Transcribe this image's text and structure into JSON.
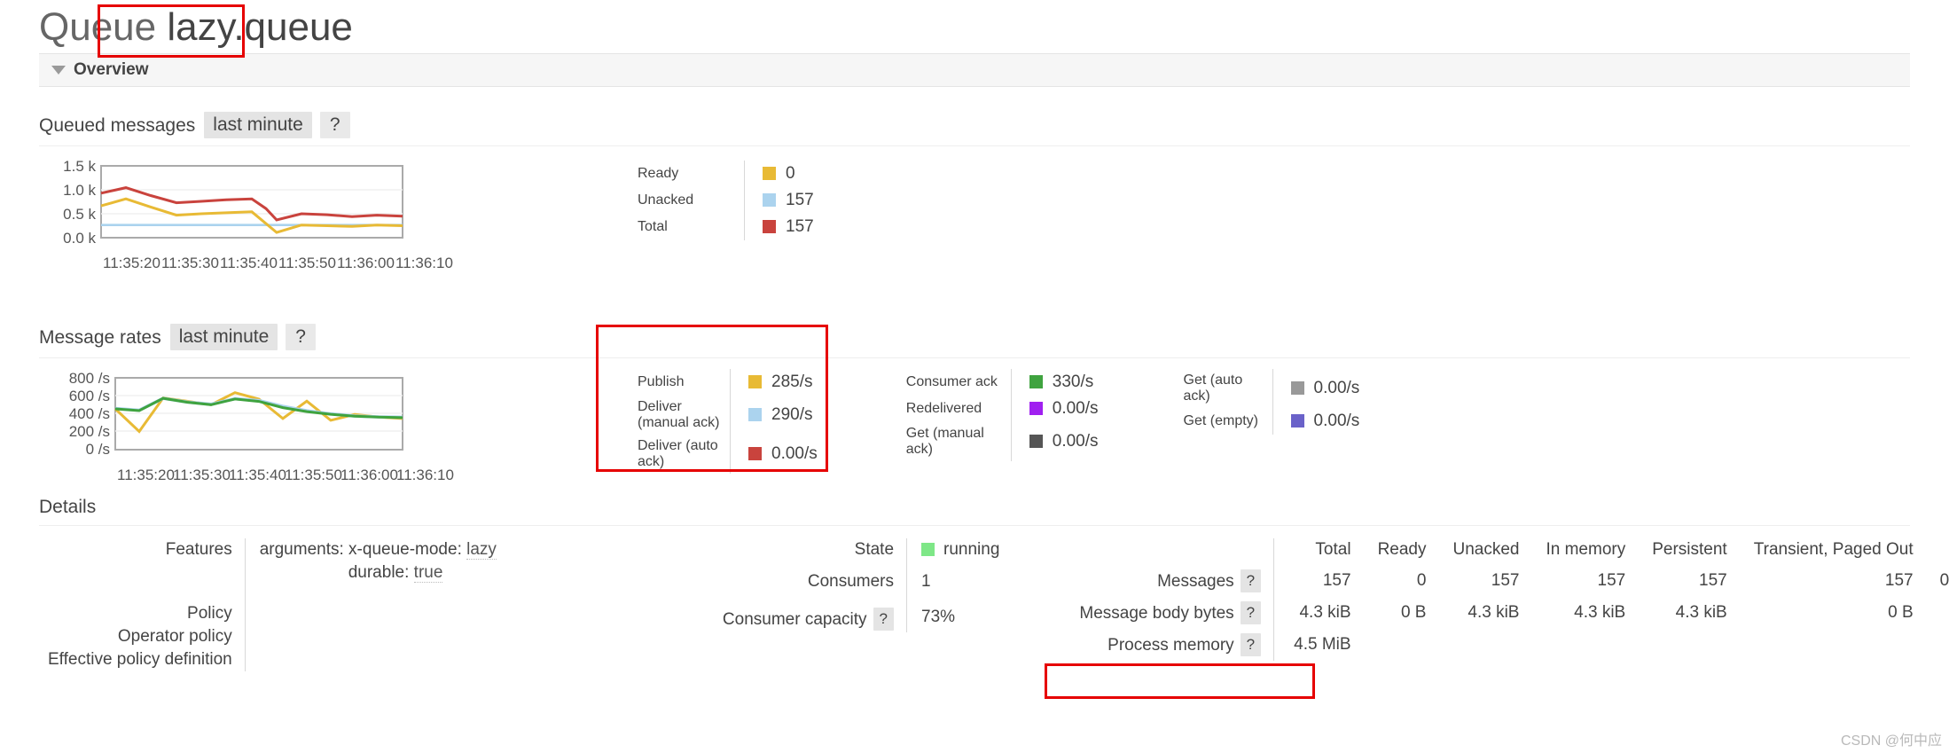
{
  "page": {
    "title_prefix": "Queue",
    "queue_name": "lazy.queue",
    "overview_label": "Overview",
    "details_label": "Details",
    "watermark": "CSDN @何中应"
  },
  "colors": {
    "ready": "#e8ba35",
    "unacked": "#abd3ee",
    "total": "#c9433d",
    "publish": "#e8ba35",
    "deliver_manual": "#abd3ee",
    "deliver_auto": "#c9433d",
    "consumer_ack": "#3fa33f",
    "redelivered": "#a020f0",
    "get_manual": "#555555",
    "get_auto": "#999999",
    "get_empty": "#6a62c9",
    "running": "#7ee787",
    "annotation": "#e60000"
  },
  "queued_messages": {
    "title": "Queued messages",
    "range_label": "last minute",
    "help": "?",
    "legend": [
      {
        "label": "Ready",
        "value": "0",
        "color": "#e8ba35"
      },
      {
        "label": "Unacked",
        "value": "157",
        "color": "#abd3ee"
      },
      {
        "label": "Total",
        "value": "157",
        "color": "#c9433d"
      }
    ]
  },
  "message_rates": {
    "title": "Message rates",
    "range_label": "last minute",
    "help": "?",
    "col1": [
      {
        "label": "Publish",
        "value": "285/s",
        "color": "#e8ba35"
      },
      {
        "label": "Deliver (manual ack)",
        "value": "290/s",
        "color": "#abd3ee"
      },
      {
        "label": "Deliver (auto ack)",
        "value": "0.00/s",
        "color": "#c9433d"
      }
    ],
    "col2": [
      {
        "label": "Consumer ack",
        "value": "330/s",
        "color": "#3fa33f"
      },
      {
        "label": "Redelivered",
        "value": "0.00/s",
        "color": "#a020f0"
      },
      {
        "label": "Get (manual ack)",
        "value": "0.00/s",
        "color": "#555555"
      }
    ],
    "col3": [
      {
        "label": "Get (auto ack)",
        "value": "0.00/s",
        "color": "#999999"
      },
      {
        "label": "Get (empty)",
        "value": "0.00/s",
        "color": "#6a62c9"
      }
    ]
  },
  "details": {
    "features_label": "Features",
    "features_arguments_key": "arguments:",
    "features_arguments_name": "x-queue-mode:",
    "features_arguments_value": "lazy",
    "features_durable_key": "durable:",
    "features_durable_value": "true",
    "policy_label": "Policy",
    "operator_policy_label": "Operator policy",
    "effective_policy_label": "Effective policy definition",
    "state_label": "State",
    "state_value": "running",
    "consumers_label": "Consumers",
    "consumers_value": "1",
    "consumer_capacity_label": "Consumer capacity",
    "consumer_capacity_help": "?",
    "consumer_capacity_value": "73%"
  },
  "stats": {
    "columns": [
      "Total",
      "Ready",
      "Unacked",
      "In memory",
      "Persistent",
      "Transient, Paged Out",
      ""
    ],
    "rows": [
      {
        "label": "Messages",
        "help": "?",
        "values": [
          "157",
          "0",
          "157",
          "157",
          "157",
          "157",
          "0"
        ]
      },
      {
        "label": "Message body bytes",
        "help": "?",
        "values": [
          "4.3 kiB",
          "0 B",
          "4.3 kiB",
          "4.3 kiB",
          "4.3 kiB",
          "0 B",
          ""
        ]
      },
      {
        "label": "Process memory",
        "help": "?",
        "values": [
          "4.5 MiB",
          "",
          "",
          "",
          "",
          "",
          ""
        ]
      }
    ]
  },
  "chart_data": [
    {
      "type": "line",
      "title": "Queued messages",
      "xlabel": "",
      "ylabel": "",
      "ylim": [
        0,
        1500
      ],
      "yticks": [
        "0.0 k",
        "0.5 k",
        "1.0 k",
        "1.5 k"
      ],
      "ytick_values": [
        0,
        500,
        1000,
        1500
      ],
      "xticks": [
        "11:35:20",
        "11:35:30",
        "11:35:40",
        "11:35:50",
        "11:36:00",
        "11:36:10"
      ],
      "grid": true,
      "legend_position": "right",
      "x": [
        0,
        1,
        2,
        3,
        4,
        5,
        6,
        7,
        8,
        9,
        10,
        11,
        12
      ],
      "series": [
        {
          "name": "Total",
          "color": "#c9433d",
          "values": [
            930,
            1045,
            880,
            730,
            760,
            790,
            810,
            370,
            500,
            480,
            440,
            470,
            450
          ]
        },
        {
          "name": "Ready",
          "color": "#e8ba35",
          "values": [
            665,
            810,
            640,
            470,
            500,
            520,
            540,
            110,
            265,
            250,
            235,
            265,
            250
          ]
        },
        {
          "name": "Unacked",
          "color": "#abd3ee",
          "values": [
            265,
            265,
            265,
            265,
            265,
            265,
            265,
            265,
            265,
            265,
            265,
            265,
            265
          ]
        }
      ]
    },
    {
      "type": "line",
      "title": "Message rates",
      "xlabel": "",
      "ylabel": "",
      "ylim": [
        0,
        800
      ],
      "yticks": [
        "0 /s",
        "200 /s",
        "400 /s",
        "600 /s",
        "800 /s"
      ],
      "ytick_values": [
        0,
        200,
        400,
        600,
        800
      ],
      "xticks": [
        "11:35:20",
        "11:35:30",
        "11:35:40",
        "11:35:50",
        "11:36:00",
        "11:36:10"
      ],
      "grid": true,
      "legend_position": "right",
      "x": [
        0,
        1,
        2,
        3,
        4,
        5,
        6,
        7,
        8,
        9,
        10,
        11,
        12
      ],
      "series": [
        {
          "name": "Publish",
          "color": "#e8ba35",
          "values": [
            455,
            200,
            575,
            540,
            500,
            635,
            560,
            350,
            540,
            330,
            395,
            370,
            355
          ]
        },
        {
          "name": "Deliver (manual ack)",
          "color": "#abd3ee",
          "values": [
            460,
            440,
            570,
            530,
            505,
            565,
            545,
            480,
            430,
            395,
            370,
            360,
            355
          ]
        },
        {
          "name": "Consumer ack",
          "color": "#3fa33f",
          "values": [
            455,
            435,
            570,
            528,
            500,
            562,
            535,
            465,
            420,
            390,
            368,
            358,
            352
          ]
        }
      ]
    }
  ]
}
